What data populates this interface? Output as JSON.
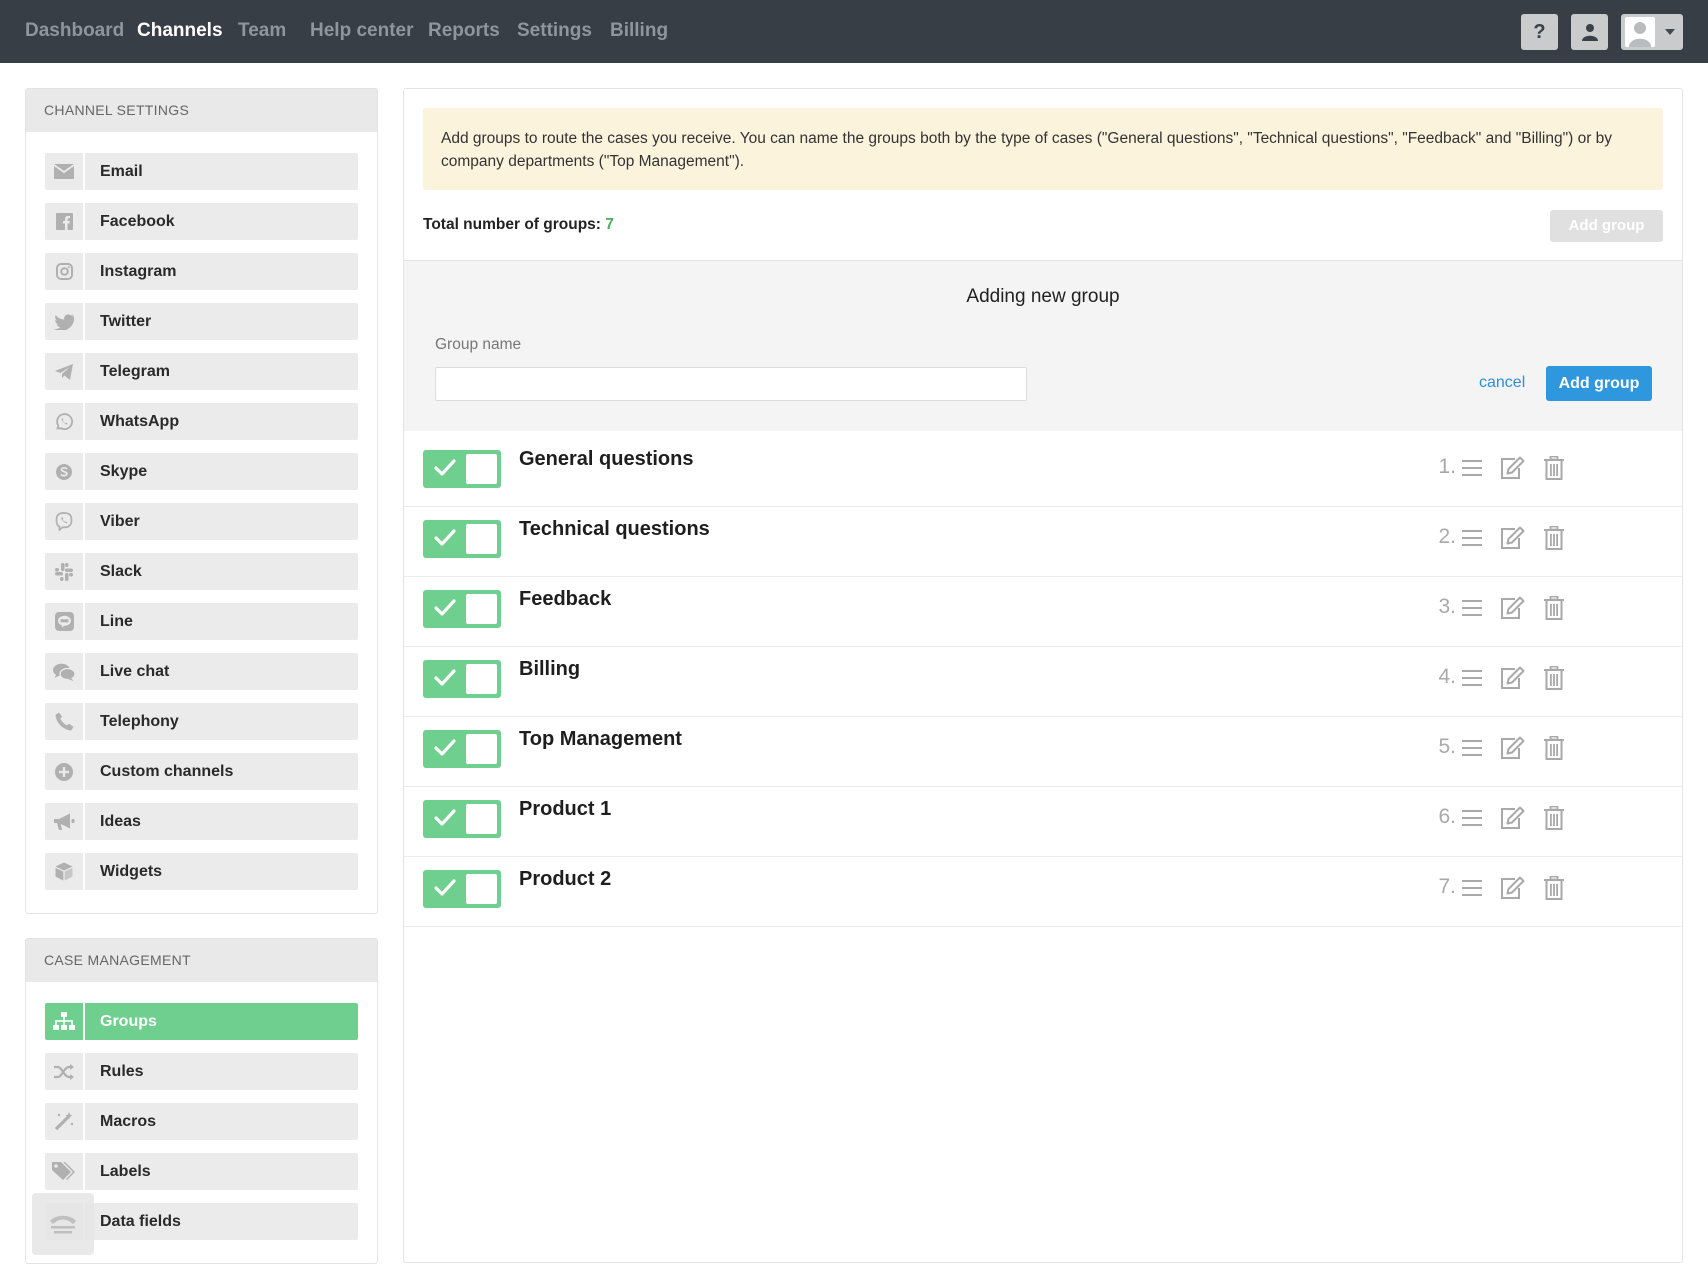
{
  "nav": {
    "items": [
      {
        "label": "Dashboard",
        "active": false
      },
      {
        "label": "Channels",
        "active": true
      },
      {
        "label": "Team",
        "active": false
      },
      {
        "label": "Help center",
        "active": false
      },
      {
        "label": "Reports",
        "active": false
      },
      {
        "label": "Settings",
        "active": false
      },
      {
        "label": "Billing",
        "active": false
      }
    ],
    "help_label": "?",
    "icons": [
      "help-icon",
      "agent-icon",
      "user-avatar-icon",
      "caret-down-icon"
    ]
  },
  "channel_settings": {
    "heading": "CHANNEL SETTINGS",
    "items": [
      {
        "label": "Email",
        "icon": "envelope-icon"
      },
      {
        "label": "Facebook",
        "icon": "facebook-icon"
      },
      {
        "label": "Instagram",
        "icon": "instagram-icon"
      },
      {
        "label": "Twitter",
        "icon": "twitter-icon"
      },
      {
        "label": "Telegram",
        "icon": "telegram-icon"
      },
      {
        "label": "WhatsApp",
        "icon": "whatsapp-icon"
      },
      {
        "label": "Skype",
        "icon": "skype-icon"
      },
      {
        "label": "Viber",
        "icon": "viber-icon"
      },
      {
        "label": "Slack",
        "icon": "slack-icon"
      },
      {
        "label": "Line",
        "icon": "line-icon"
      },
      {
        "label": "Live chat",
        "icon": "chat-bubbles-icon"
      },
      {
        "label": "Telephony",
        "icon": "phone-icon"
      },
      {
        "label": "Custom channels",
        "icon": "plus-circle-icon"
      },
      {
        "label": "Ideas",
        "icon": "megaphone-icon"
      },
      {
        "label": "Widgets",
        "icon": "cube-icon"
      }
    ]
  },
  "case_management": {
    "heading": "CASE MANAGEMENT",
    "items": [
      {
        "label": "Groups",
        "icon": "sitemap-icon",
        "active": true
      },
      {
        "label": "Rules",
        "icon": "shuffle-icon",
        "active": false
      },
      {
        "label": "Macros",
        "icon": "magic-wand-icon",
        "active": false
      },
      {
        "label": "Labels",
        "icon": "tags-icon",
        "active": false
      },
      {
        "label": "Data fields",
        "icon": "data-fields-icon",
        "active": false
      }
    ]
  },
  "main": {
    "notice": "Add groups to route the cases you receive. You can name the groups both by the type of cases (\"General questions\", \"Technical questions\", \"Feedback\" and \"Billing\") or by company departments (\"Top Management\").",
    "total_label": "Total number of groups:",
    "total_value": "7",
    "add_group_top_label": "Add group",
    "form": {
      "title": "Adding new group",
      "field_label": "Group name",
      "field_value": "",
      "field_placeholder": "",
      "cancel_label": "cancel",
      "submit_label": "Add group"
    },
    "groups": [
      {
        "name": "General questions",
        "index": "1.",
        "enabled": true
      },
      {
        "name": "Technical questions",
        "index": "2.",
        "enabled": true
      },
      {
        "name": "Feedback",
        "index": "3.",
        "enabled": true
      },
      {
        "name": "Billing",
        "index": "4.",
        "enabled": true
      },
      {
        "name": "Top Management",
        "index": "5.",
        "enabled": true
      },
      {
        "name": "Product 1",
        "index": "6.",
        "enabled": true
      },
      {
        "name": "Product 2",
        "index": "7.",
        "enabled": true
      }
    ],
    "row_icons": [
      "drag-handle-icon",
      "edit-icon",
      "trash-icon"
    ]
  },
  "colors": {
    "topbar": "#383e46",
    "accent_green": "#6fcf8f",
    "primary_blue": "#2e97de",
    "notice_bg": "#fcf3dd",
    "count_green": "#4caf60"
  }
}
